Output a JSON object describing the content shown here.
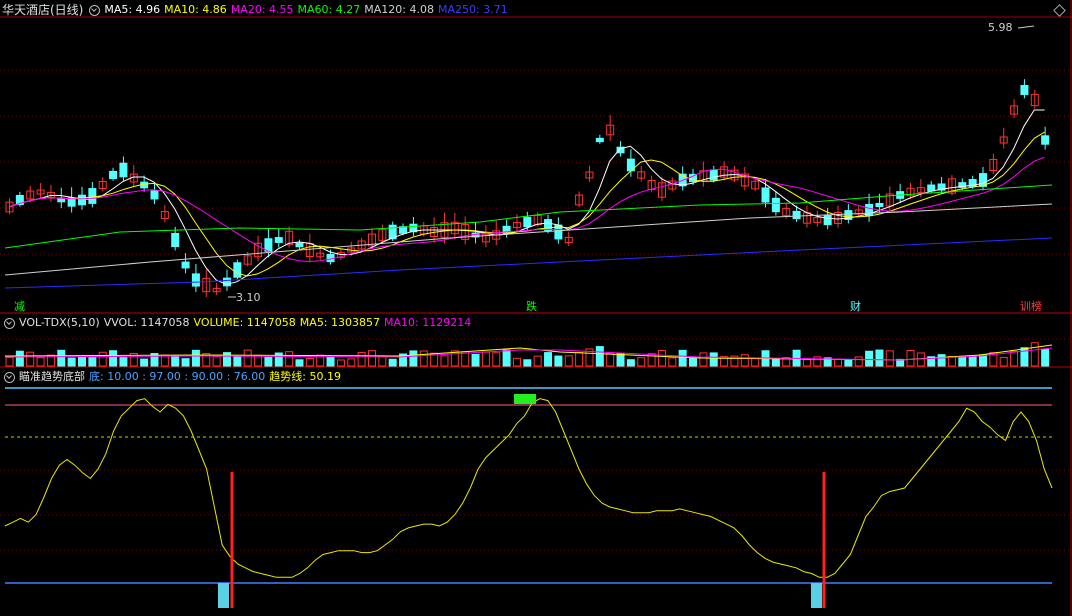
{
  "colors": {
    "up": "#ff3232",
    "down": "#54ffff",
    "ma5": "#ffffff",
    "ma10": "#ffff00",
    "ma20": "#ff00ff",
    "ma60": "#00ff00",
    "ma120": "#d0d0d0",
    "ma250": "#2a2aff",
    "grid": "#7a0000"
  },
  "main": {
    "stock_title": "华天酒店(日线)",
    "ma_labels": [
      {
        "text": "MA5: 4.96",
        "color": "#ffffff"
      },
      {
        "text": "MA10: 4.86",
        "color": "#ffff00"
      },
      {
        "text": "MA20: 4.55",
        "color": "#ff00ff"
      },
      {
        "text": "MA60: 4.27",
        "color": "#00ff00"
      },
      {
        "text": "MA120: 4.08",
        "color": "#d0d0d0"
      },
      {
        "text": "MA250: 3.71",
        "color": "#3c3cff"
      }
    ],
    "high_label": "5.98",
    "low_label": "3.10",
    "markers": [
      {
        "text": "减",
        "color": "#00ff00"
      },
      {
        "text": "跌",
        "color": "#00ff00"
      },
      {
        "text": "财",
        "color": "#54ffff"
      },
      {
        "text": "训榜",
        "color": "#ff4040"
      }
    ]
  },
  "volume": {
    "labels": [
      {
        "text": "VOL-TDX(5,10)",
        "color": "#e0e0e0"
      },
      {
        "text": "VVOL: 1147058",
        "color": "#e0e0e0"
      },
      {
        "text": "VOLUME: 1147058",
        "color": "#ffff00"
      },
      {
        "text": "MA5: 1303857",
        "color": "#ffff00"
      },
      {
        "text": "MA10: 1129214",
        "color": "#ff00ff"
      }
    ]
  },
  "indicator": {
    "labels": [
      {
        "text": "瞄准趋势底部",
        "color": "#e0e0e0"
      },
      {
        "text": "底: 10.00 : 97.00 : 90.00 : 76.00",
        "color": "#4aa3ff"
      },
      {
        "text": "趋势线: 50.19",
        "color": "#ffff00"
      }
    ],
    "trend_line": [
      30,
      32,
      34,
      32,
      36,
      45,
      55,
      62,
      65,
      62,
      58,
      55,
      60,
      68,
      80,
      88,
      92,
      96,
      97,
      93,
      90,
      94,
      92,
      88,
      80,
      70,
      60,
      40,
      20,
      14,
      10,
      8,
      6,
      5,
      4,
      3,
      3,
      3,
      5,
      8,
      12,
      15,
      16,
      17,
      17,
      17,
      16,
      16,
      17,
      20,
      23,
      27,
      29,
      30,
      31,
      31,
      30,
      32,
      36,
      42,
      50,
      60,
      66,
      70,
      74,
      78,
      84,
      88,
      95,
      97,
      96,
      90,
      80,
      70,
      60,
      52,
      46,
      42,
      40,
      39,
      38,
      37,
      37,
      37,
      38,
      38,
      38,
      39,
      38,
      37,
      36,
      35,
      33,
      31,
      29,
      25,
      20,
      16,
      13,
      11,
      10,
      9,
      8,
      6,
      5,
      3,
      3,
      5,
      10,
      15,
      25,
      35,
      40,
      46,
      48,
      49,
      50,
      55,
      60,
      65,
      70,
      75,
      80,
      85,
      92,
      90,
      85,
      82,
      78,
      75,
      85,
      90,
      85,
      75,
      60,
      50
    ]
  }
}
